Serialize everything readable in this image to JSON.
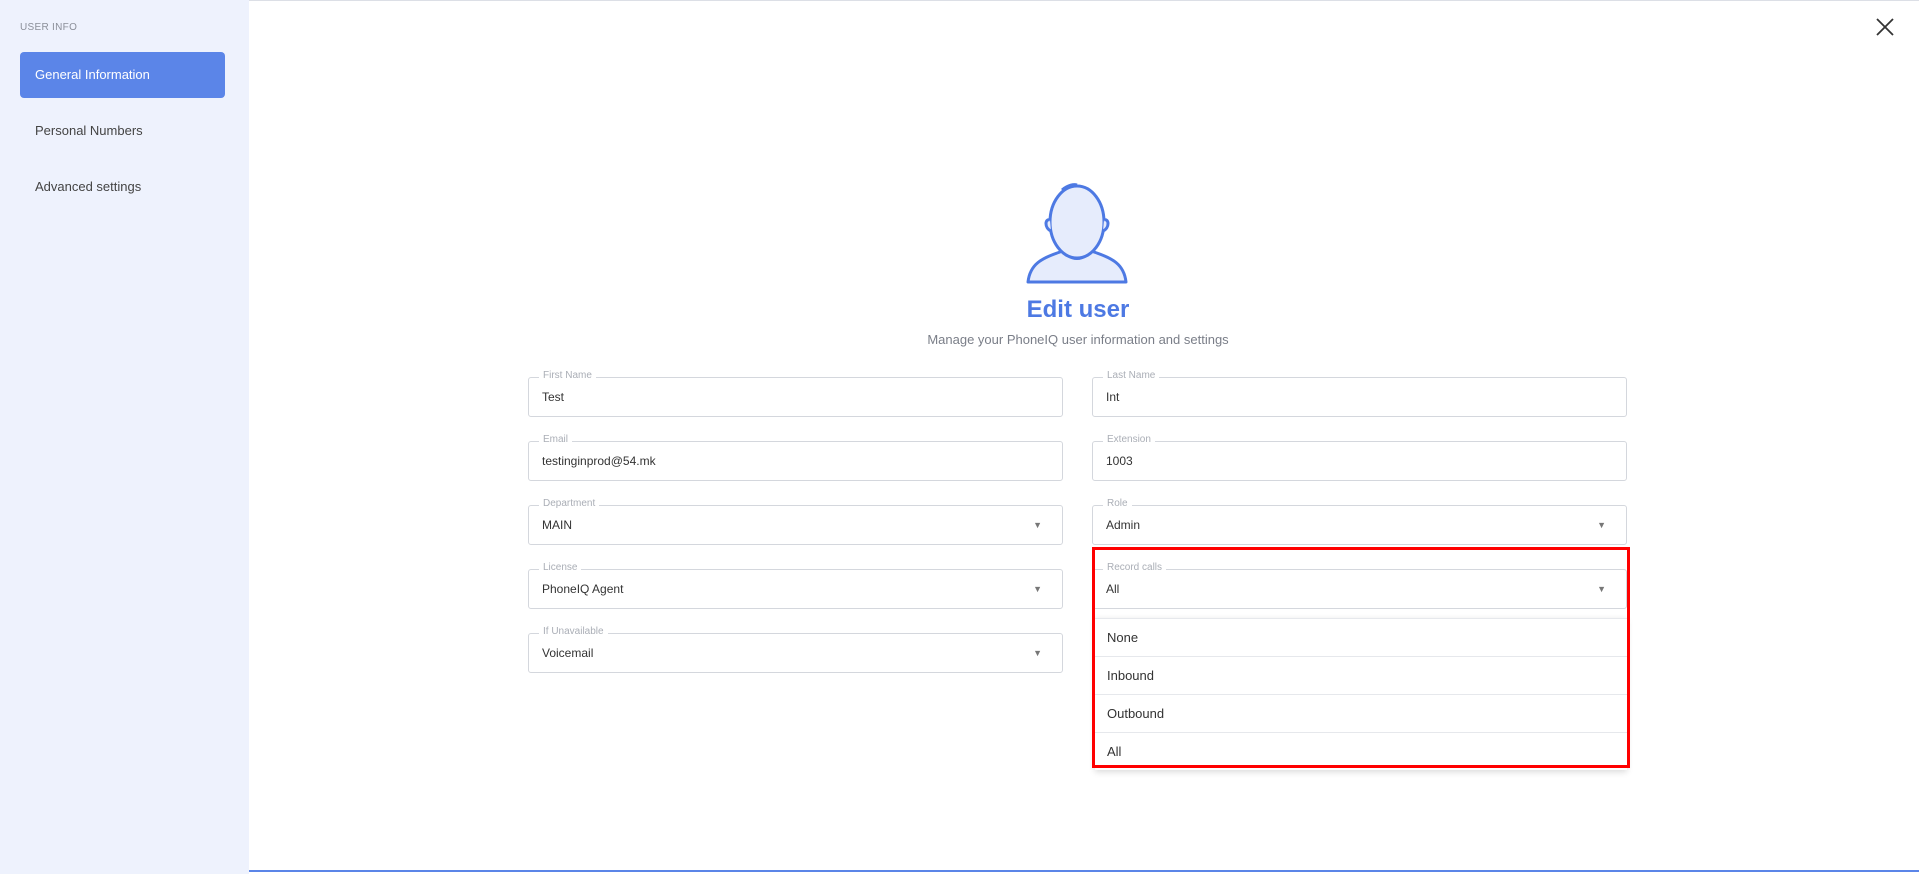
{
  "sidebar": {
    "title": "USER INFO",
    "items": [
      {
        "label": "General Information",
        "active": true
      },
      {
        "label": "Personal Numbers",
        "active": false
      },
      {
        "label": "Advanced settings",
        "active": false
      }
    ]
  },
  "header": {
    "title": "Edit user",
    "subtitle": "Manage your PhoneIQ user information and settings",
    "close_icon": "close-icon",
    "avatar_icon": "user-avatar-icon"
  },
  "form": {
    "first_name": {
      "label": "First Name",
      "value": "Test"
    },
    "last_name": {
      "label": "Last Name",
      "value": "Int"
    },
    "email": {
      "label": "Email",
      "value": "testinginprod@54.mk"
    },
    "extension": {
      "label": "Extension",
      "value": "1003"
    },
    "department": {
      "label": "Department",
      "value": "MAIN"
    },
    "role": {
      "label": "Role",
      "value": "Admin"
    },
    "license": {
      "label": "License",
      "value": "PhoneIQ Agent"
    },
    "record_calls": {
      "label": "Record calls",
      "value": "All",
      "options": [
        "None",
        "Inbound",
        "Outbound",
        "All"
      ]
    },
    "if_unavailable": {
      "label": "If Unavailable",
      "value": "Voicemail"
    }
  },
  "colors": {
    "accent": "#5b85e8",
    "title": "#4d79e3",
    "sidebar_bg": "#eef2fd",
    "highlight": "#ff0000"
  }
}
